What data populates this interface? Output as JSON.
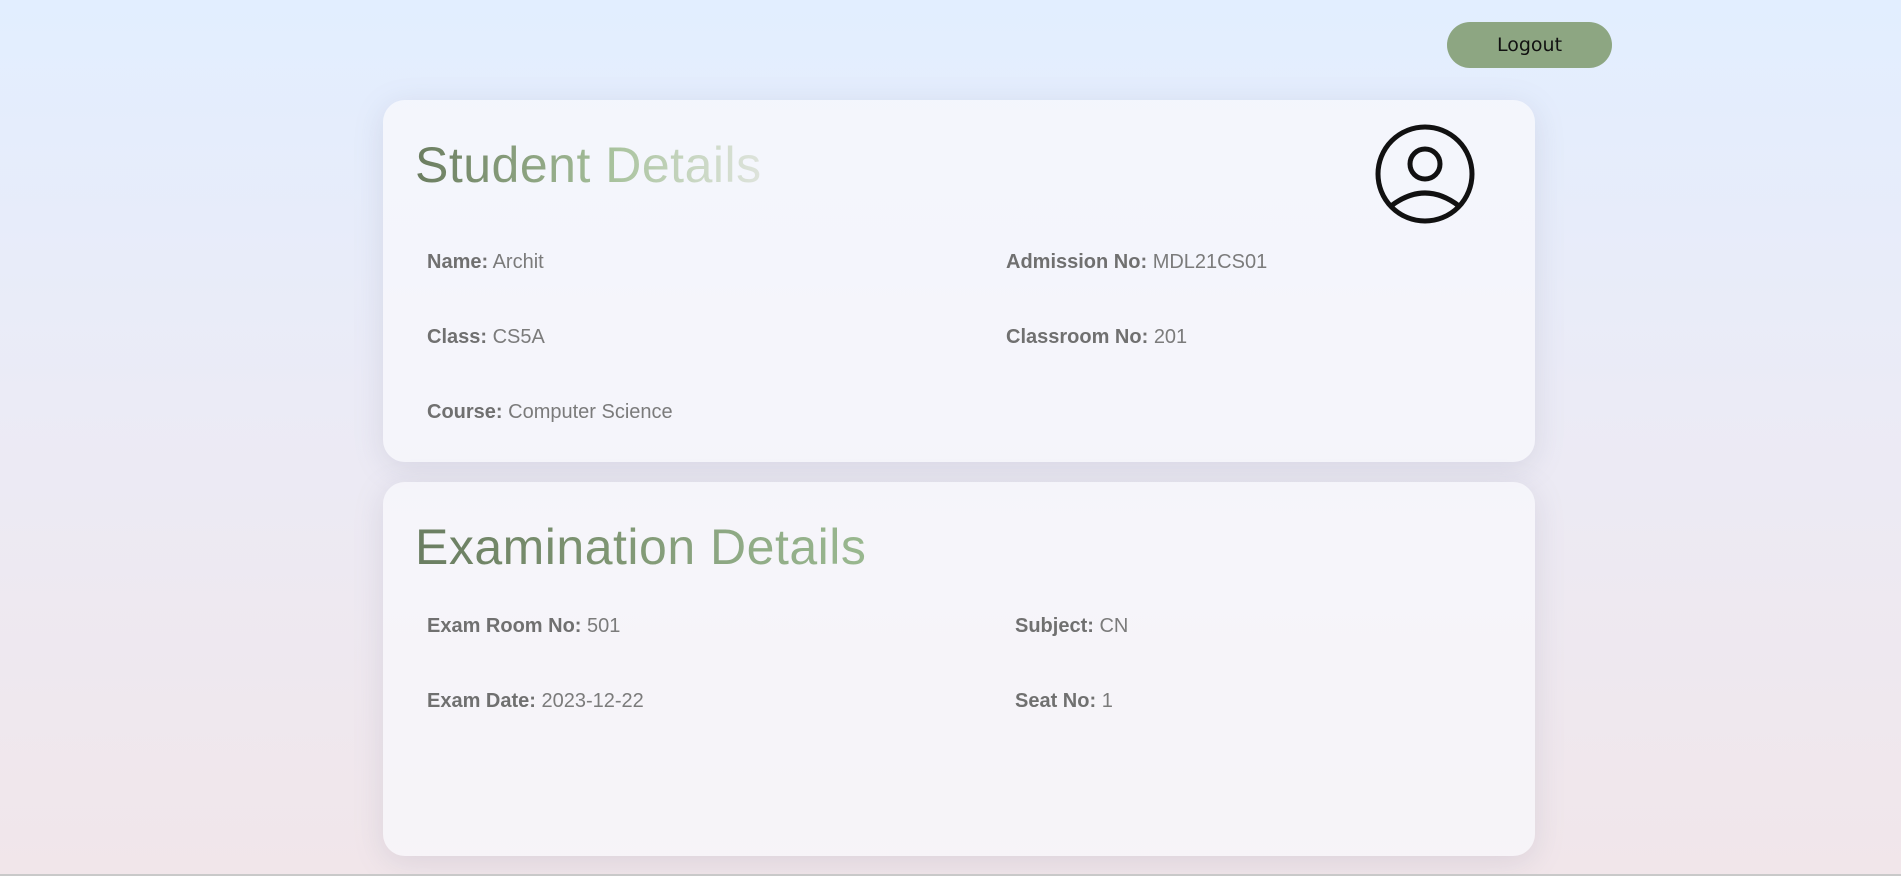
{
  "header": {
    "logout_label": "Logout"
  },
  "student": {
    "title": "Student Details",
    "avatar_icon": "user-circle-icon",
    "fields": {
      "name": {
        "label": "Name:",
        "value": "Archit"
      },
      "admission_no": {
        "label": "Admission No:",
        "value": "MDL21CS01"
      },
      "class": {
        "label": "Class:",
        "value": "CS5A"
      },
      "classroom_no": {
        "label": "Classroom No:",
        "value": "201"
      },
      "course": {
        "label": "Course:",
        "value": "Computer Science"
      }
    }
  },
  "exam": {
    "title": "Examination Details",
    "fields": {
      "exam_room_no": {
        "label": "Exam Room No:",
        "value": "501"
      },
      "subject": {
        "label": "Subject:",
        "value": "CN"
      },
      "exam_date": {
        "label": "Exam Date:",
        "value": "2023-12-22"
      },
      "seat_no": {
        "label": "Seat No:",
        "value": "1"
      }
    }
  },
  "colors": {
    "accent": "#8da682",
    "title_dark": "#6b7d60",
    "text": "#7b7b7b"
  }
}
